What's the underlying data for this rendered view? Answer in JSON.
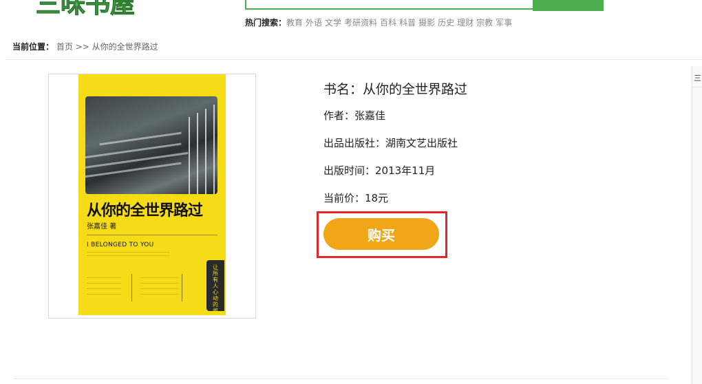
{
  "header": {
    "logo_text": "三味书屋",
    "hot_search": {
      "label": "热门搜索：",
      "keywords": [
        "教育",
        "外语",
        "文学",
        "考研资料",
        "百科",
        "科普",
        "摄影",
        "历史",
        "理财",
        "宗教",
        "军事"
      ]
    }
  },
  "breadcrumb": {
    "label": "当前位置：",
    "home": "首页",
    "separator": ">>",
    "current": "从你的全世界路过"
  },
  "cover": {
    "title": "从你的全世界路过",
    "author_line": "张嘉佳 著",
    "english_title": "I BELONGED TO YOU",
    "side_text": "让所有人心动的故事"
  },
  "book": {
    "title": "书名：从你的全世界路过",
    "author": "作者：张嘉佳",
    "publisher": "出品出版社：湖南文艺出版社",
    "pub_date": "出版时间：2013年11月",
    "price": "当前价：18元"
  },
  "buy_button_label": "购买",
  "right_panel": {
    "tab_char": "三"
  },
  "colors": {
    "brand_green": "#4cae4c",
    "buy_orange": "#f0a616",
    "highlight_red": "#e3262b",
    "cover_yellow": "#f5dc17"
  }
}
